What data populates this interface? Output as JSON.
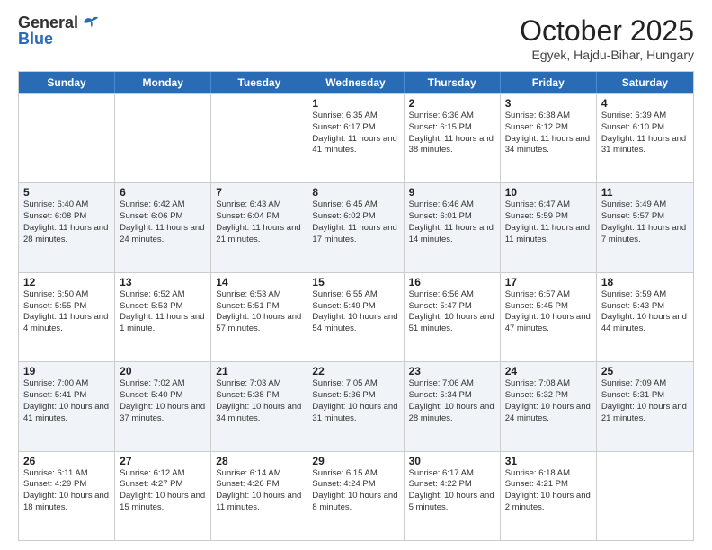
{
  "header": {
    "logo_general": "General",
    "logo_blue": "Blue",
    "month_title": "October 2025",
    "location": "Egyek, Hajdu-Bihar, Hungary"
  },
  "days_of_week": [
    "Sunday",
    "Monday",
    "Tuesday",
    "Wednesday",
    "Thursday",
    "Friday",
    "Saturday"
  ],
  "weeks": [
    [
      {
        "day": "",
        "text": ""
      },
      {
        "day": "",
        "text": ""
      },
      {
        "day": "",
        "text": ""
      },
      {
        "day": "1",
        "text": "Sunrise: 6:35 AM\nSunset: 6:17 PM\nDaylight: 11 hours and 41 minutes."
      },
      {
        "day": "2",
        "text": "Sunrise: 6:36 AM\nSunset: 6:15 PM\nDaylight: 11 hours and 38 minutes."
      },
      {
        "day": "3",
        "text": "Sunrise: 6:38 AM\nSunset: 6:12 PM\nDaylight: 11 hours and 34 minutes."
      },
      {
        "day": "4",
        "text": "Sunrise: 6:39 AM\nSunset: 6:10 PM\nDaylight: 11 hours and 31 minutes."
      }
    ],
    [
      {
        "day": "5",
        "text": "Sunrise: 6:40 AM\nSunset: 6:08 PM\nDaylight: 11 hours and 28 minutes."
      },
      {
        "day": "6",
        "text": "Sunrise: 6:42 AM\nSunset: 6:06 PM\nDaylight: 11 hours and 24 minutes."
      },
      {
        "day": "7",
        "text": "Sunrise: 6:43 AM\nSunset: 6:04 PM\nDaylight: 11 hours and 21 minutes."
      },
      {
        "day": "8",
        "text": "Sunrise: 6:45 AM\nSunset: 6:02 PM\nDaylight: 11 hours and 17 minutes."
      },
      {
        "day": "9",
        "text": "Sunrise: 6:46 AM\nSunset: 6:01 PM\nDaylight: 11 hours and 14 minutes."
      },
      {
        "day": "10",
        "text": "Sunrise: 6:47 AM\nSunset: 5:59 PM\nDaylight: 11 hours and 11 minutes."
      },
      {
        "day": "11",
        "text": "Sunrise: 6:49 AM\nSunset: 5:57 PM\nDaylight: 11 hours and 7 minutes."
      }
    ],
    [
      {
        "day": "12",
        "text": "Sunrise: 6:50 AM\nSunset: 5:55 PM\nDaylight: 11 hours and 4 minutes."
      },
      {
        "day": "13",
        "text": "Sunrise: 6:52 AM\nSunset: 5:53 PM\nDaylight: 11 hours and 1 minute."
      },
      {
        "day": "14",
        "text": "Sunrise: 6:53 AM\nSunset: 5:51 PM\nDaylight: 10 hours and 57 minutes."
      },
      {
        "day": "15",
        "text": "Sunrise: 6:55 AM\nSunset: 5:49 PM\nDaylight: 10 hours and 54 minutes."
      },
      {
        "day": "16",
        "text": "Sunrise: 6:56 AM\nSunset: 5:47 PM\nDaylight: 10 hours and 51 minutes."
      },
      {
        "day": "17",
        "text": "Sunrise: 6:57 AM\nSunset: 5:45 PM\nDaylight: 10 hours and 47 minutes."
      },
      {
        "day": "18",
        "text": "Sunrise: 6:59 AM\nSunset: 5:43 PM\nDaylight: 10 hours and 44 minutes."
      }
    ],
    [
      {
        "day": "19",
        "text": "Sunrise: 7:00 AM\nSunset: 5:41 PM\nDaylight: 10 hours and 41 minutes."
      },
      {
        "day": "20",
        "text": "Sunrise: 7:02 AM\nSunset: 5:40 PM\nDaylight: 10 hours and 37 minutes."
      },
      {
        "day": "21",
        "text": "Sunrise: 7:03 AM\nSunset: 5:38 PM\nDaylight: 10 hours and 34 minutes."
      },
      {
        "day": "22",
        "text": "Sunrise: 7:05 AM\nSunset: 5:36 PM\nDaylight: 10 hours and 31 minutes."
      },
      {
        "day": "23",
        "text": "Sunrise: 7:06 AM\nSunset: 5:34 PM\nDaylight: 10 hours and 28 minutes."
      },
      {
        "day": "24",
        "text": "Sunrise: 7:08 AM\nSunset: 5:32 PM\nDaylight: 10 hours and 24 minutes."
      },
      {
        "day": "25",
        "text": "Sunrise: 7:09 AM\nSunset: 5:31 PM\nDaylight: 10 hours and 21 minutes."
      }
    ],
    [
      {
        "day": "26",
        "text": "Sunrise: 6:11 AM\nSunset: 4:29 PM\nDaylight: 10 hours and 18 minutes."
      },
      {
        "day": "27",
        "text": "Sunrise: 6:12 AM\nSunset: 4:27 PM\nDaylight: 10 hours and 15 minutes."
      },
      {
        "day": "28",
        "text": "Sunrise: 6:14 AM\nSunset: 4:26 PM\nDaylight: 10 hours and 11 minutes."
      },
      {
        "day": "29",
        "text": "Sunrise: 6:15 AM\nSunset: 4:24 PM\nDaylight: 10 hours and 8 minutes."
      },
      {
        "day": "30",
        "text": "Sunrise: 6:17 AM\nSunset: 4:22 PM\nDaylight: 10 hours and 5 minutes."
      },
      {
        "day": "31",
        "text": "Sunrise: 6:18 AM\nSunset: 4:21 PM\nDaylight: 10 hours and 2 minutes."
      },
      {
        "day": "",
        "text": ""
      }
    ]
  ]
}
